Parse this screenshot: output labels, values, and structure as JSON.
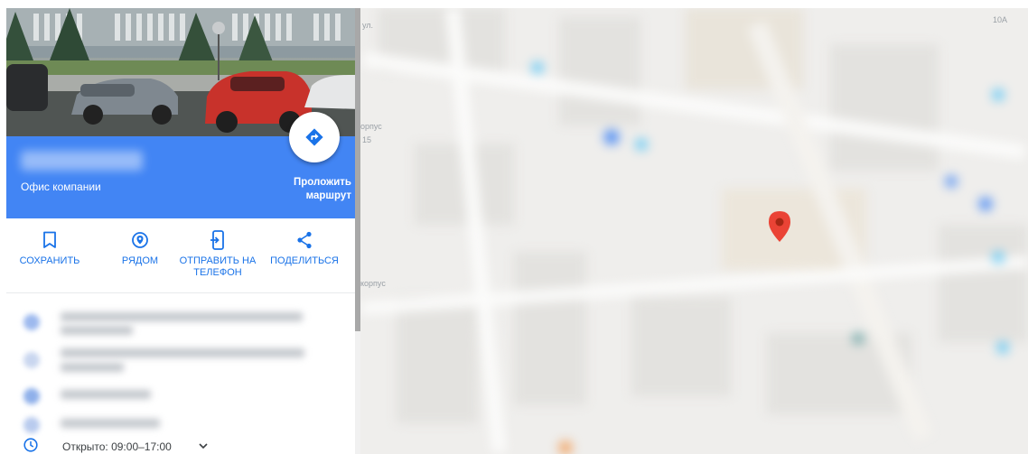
{
  "place": {
    "category": "Офис компании",
    "route_label": "Проложить маршрут"
  },
  "actions": [
    {
      "label": "СОХРАНИТЬ",
      "icon": "bookmark-icon"
    },
    {
      "label": "РЯДОМ",
      "icon": "nearby-icon"
    },
    {
      "label": "ОТПРАВИТЬ НА ТЕЛЕФОН",
      "icon": "send-to-phone-icon"
    },
    {
      "label": "ПОДЕЛИТЬСЯ",
      "icon": "share-icon"
    }
  ],
  "hours": {
    "text": "Открыто: 09:00–17:00"
  },
  "map_labels": {
    "top_left": "ул.",
    "korpus_1": "орпус",
    "num_15": "15",
    "korpus_2": "корпус",
    "top_right": "10А"
  },
  "colors": {
    "accent": "#4285f4",
    "action_blue": "#1a73e8",
    "pin_red": "#ea4335"
  }
}
